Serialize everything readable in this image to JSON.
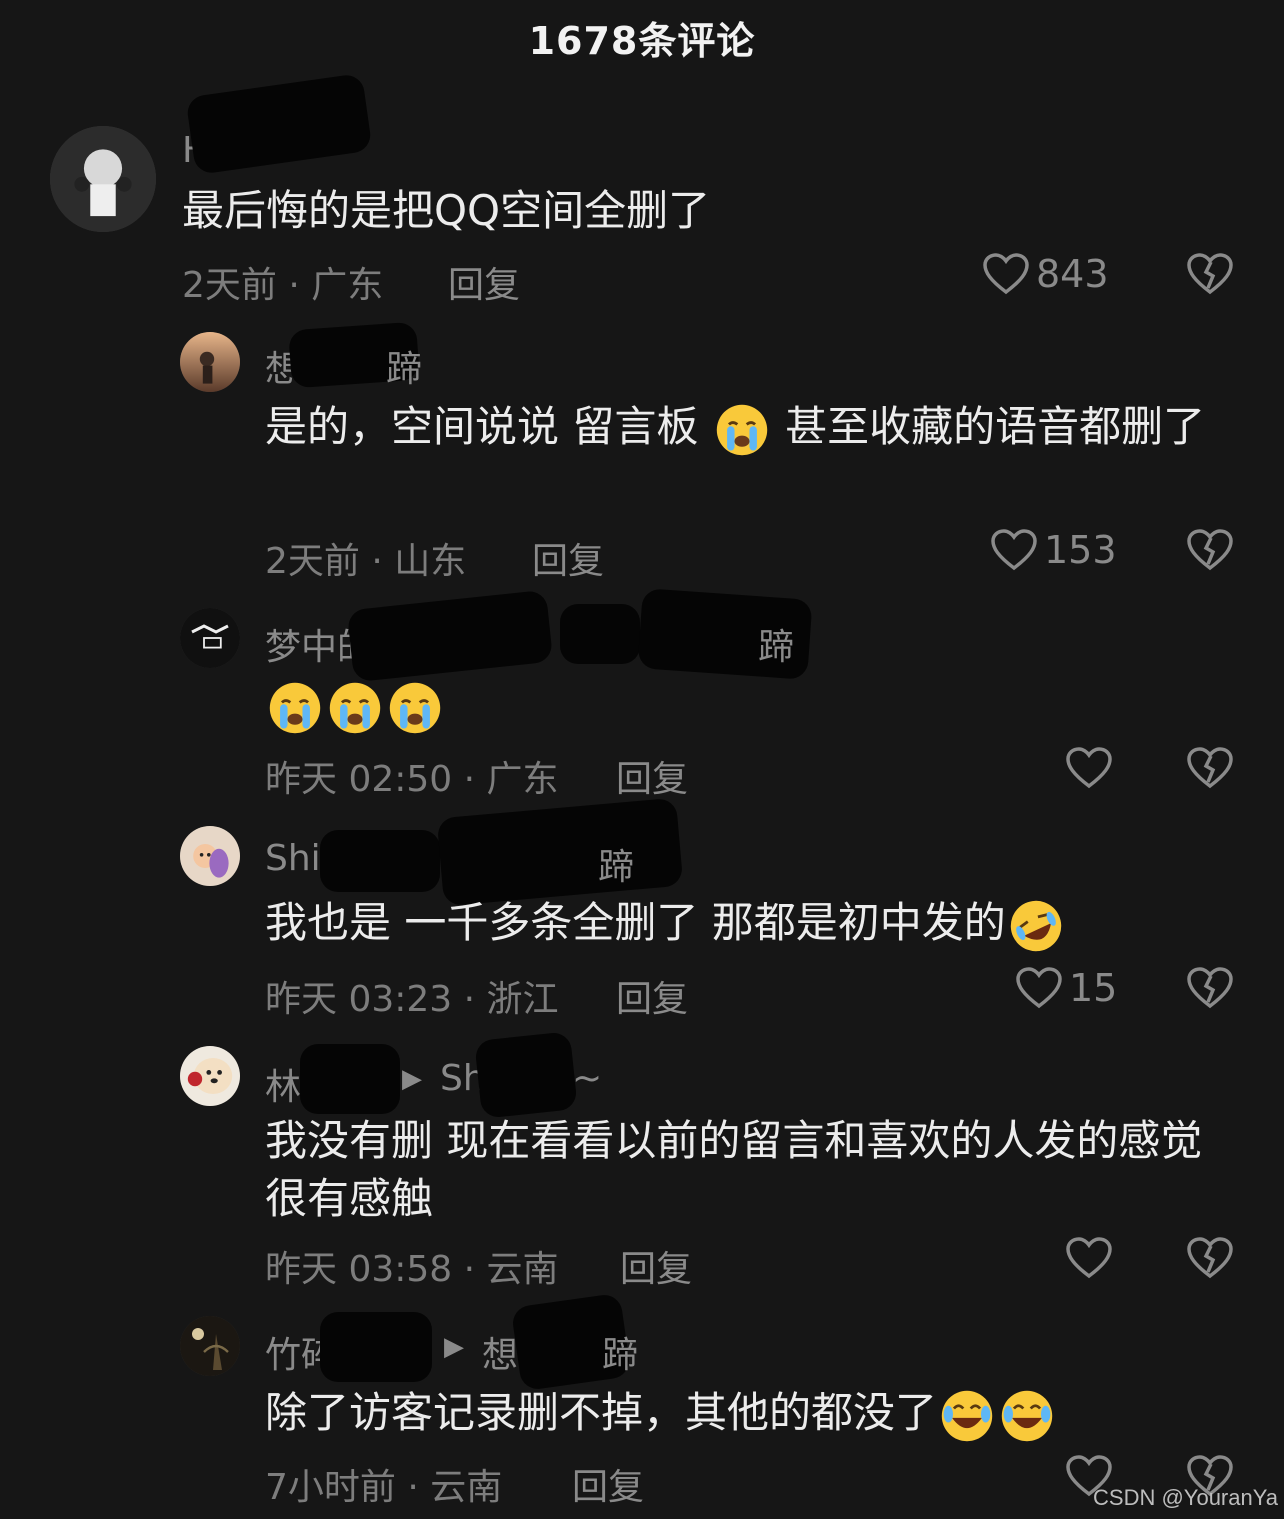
{
  "header": {
    "title": "1678条评论"
  },
  "comments": [
    {
      "username": "H",
      "text": "最后悔的是把QQ空间全删了",
      "meta": "2天前 · 广东",
      "reply_label": "回复",
      "likes": "843"
    },
    {
      "username": "想",
      "username_tail": "蹄",
      "text": "是的，空间说说 留言板",
      "text2": "甚至收藏的语音都删了",
      "meta": "2天前 · 山东",
      "reply_label": "回复",
      "likes": "153"
    },
    {
      "username": "梦中的船",
      "username_tail": "蹄",
      "text": "",
      "meta": "昨天 02:50 · 广东",
      "reply_label": "回复",
      "likes": ""
    },
    {
      "username": "Shi",
      "username_tail": "蹄",
      "text": "我也是 一千多条全删了 那都是初中发的",
      "meta": "昨天 03:23 · 浙江",
      "reply_label": "回复",
      "likes": "15"
    },
    {
      "username": "林",
      "reply_to": "Sh",
      "reply_to_tail": "~",
      "text": "我没有删  现在看看以前的留言和喜欢的人发的感觉很有感触",
      "meta": "昨天 03:58 · 云南",
      "reply_label": "回复",
      "likes": ""
    },
    {
      "username": "竹碎",
      "reply_to": "想",
      "reply_to_tail": "蹄",
      "text": "除了访客记录删不掉，其他的都没了",
      "meta": "7小时前 · 云南",
      "reply_label": "回复",
      "likes": ""
    }
  ],
  "icons": {
    "like": "heart-outline-icon",
    "dislike": "broken-heart-icon",
    "emoji_cry": "loudly-crying-face-emoji",
    "emoji_laugh": "rolling-laughing-emoji",
    "emoji_joy": "tears-of-joy-emoji"
  },
  "watermark": "CSDN @YouranYa"
}
